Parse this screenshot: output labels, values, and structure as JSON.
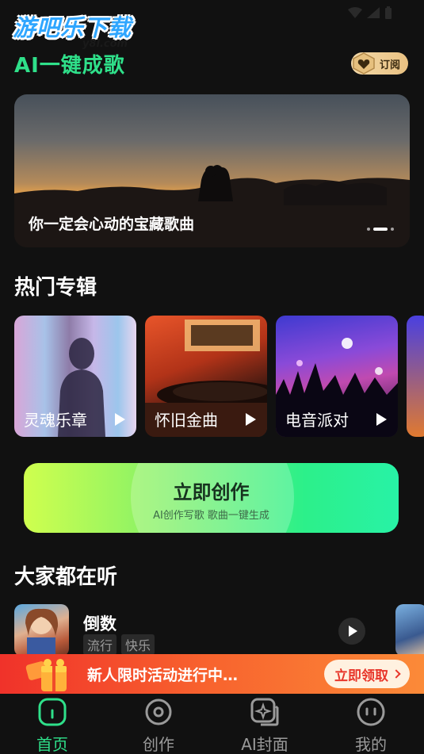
{
  "watermark": {
    "main": "游吧乐下载",
    "sub": "y8l.com"
  },
  "header": {
    "title": "AI一键成歌",
    "subscribe_label": "订阅"
  },
  "banner": {
    "caption": "你一定会心动的宝藏歌曲",
    "page_count": 3,
    "active_page": 2
  },
  "albums_section": {
    "title": "热门专辑",
    "items": [
      {
        "label": "灵魂乐章"
      },
      {
        "label": "怀旧金曲"
      },
      {
        "label": "电音派对"
      },
      {
        "label": ""
      }
    ]
  },
  "create_button": {
    "title": "立即创作",
    "subtitle": "AI创作写歌 歌曲一键生成"
  },
  "listening_section": {
    "title": "大家都在听",
    "songs": [
      {
        "title": "倒数",
        "tags": [
          "流行",
          "快乐"
        ]
      }
    ]
  },
  "promo": {
    "text": "新人限时活动进行中…",
    "button_label": "立即领取"
  },
  "tabbar": {
    "active": "首页",
    "tabs": [
      {
        "label": "首页",
        "icon": "home-icon"
      },
      {
        "label": "创作",
        "icon": "disc-icon"
      },
      {
        "label": "AI封面",
        "icon": "ai-cover-icon"
      },
      {
        "label": "我的",
        "icon": "profile-icon"
      }
    ]
  },
  "colors": {
    "accent": "#2fe08a",
    "background": "#111111",
    "promo": "#f0322a"
  }
}
